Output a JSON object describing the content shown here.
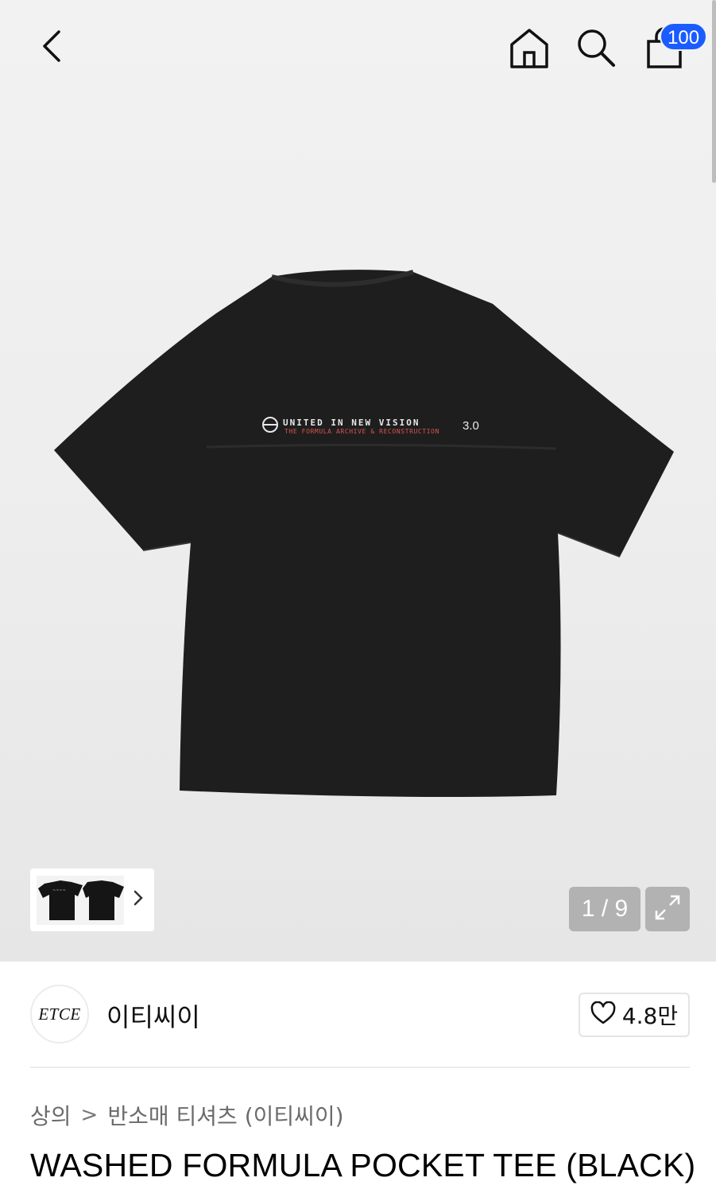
{
  "header": {
    "back_icon": "chevron-left-icon",
    "home_icon": "home-icon",
    "search_icon": "search-icon",
    "cart_icon": "shopping-bag-icon",
    "cart_badge": "100",
    "badge_color": "#1a5cff"
  },
  "gallery": {
    "shirt_print_line1": "UNITED IN NEW VISION",
    "shirt_print_line2": "THE FORMULA ARCHIVE & RECONSTRUCTION",
    "shirt_print_version": "3.0",
    "counter": "1 / 9",
    "expand_icon": "expand-icon"
  },
  "brand": {
    "logo_text": "ETCE",
    "name": "이티씨이",
    "like_count": "4.8만",
    "like_icon": "heart-icon"
  },
  "breadcrumb": {
    "category": "상의",
    "separator": ">",
    "subcategory": "반소매 티셔츠 (이티씨이)"
  },
  "product": {
    "title": "WASHED FORMULA POCKET TEE (BLACK)"
  }
}
